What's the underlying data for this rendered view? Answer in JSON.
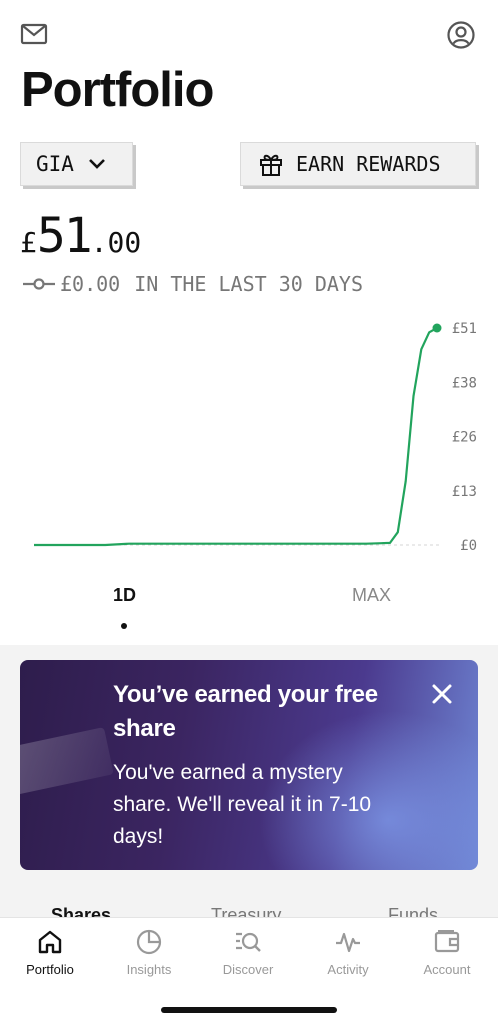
{
  "header": {
    "mail_icon": "mail-icon",
    "profile_icon": "profile-icon",
    "title": "Portfolio"
  },
  "account_selector": {
    "value": "GIA",
    "icon": "chevron-down-icon"
  },
  "rewards_button": {
    "label": "EARN REWARDS",
    "icon": "gift-icon"
  },
  "balance": {
    "currency": "£",
    "integer": "51",
    "decimal": ".00"
  },
  "change": {
    "amount": "£0.00",
    "period": "IN THE LAST 30 DAYS",
    "icon": "flat-line-icon"
  },
  "chart_data": {
    "type": "line",
    "y_ticks": [
      "£51",
      "£38",
      "£26",
      "£13",
      "£0"
    ],
    "ylim": [
      0,
      51
    ],
    "series": [
      {
        "values": [
          0,
          0,
          0,
          0,
          0.3,
          0.3,
          0.3,
          0.3,
          0.3,
          0.3,
          0.3,
          0.3,
          0.3,
          0.3,
          0.3,
          0.5,
          3,
          15,
          35,
          46,
          50,
          51
        ]
      }
    ],
    "line_color": "#22a45d"
  },
  "range_tabs": {
    "selected": "1D",
    "options": [
      "1D",
      "MAX"
    ]
  },
  "promo": {
    "title": "You’ve earned your free share",
    "body": "You've earned a mystery share. We'll reveal it in 7-10 days!",
    "close_icon": "close-icon"
  },
  "holdings_tabs": [
    "Shares",
    "Treasury",
    "Funds"
  ],
  "bottom_nav": [
    {
      "label": "Portfolio",
      "icon": "home-icon",
      "active": true
    },
    {
      "label": "Insights",
      "icon": "pie-chart-icon",
      "active": false
    },
    {
      "label": "Discover",
      "icon": "search-list-icon",
      "active": false
    },
    {
      "label": "Activity",
      "icon": "activity-icon",
      "active": false
    },
    {
      "label": "Account",
      "icon": "wallet-icon",
      "active": false
    }
  ]
}
